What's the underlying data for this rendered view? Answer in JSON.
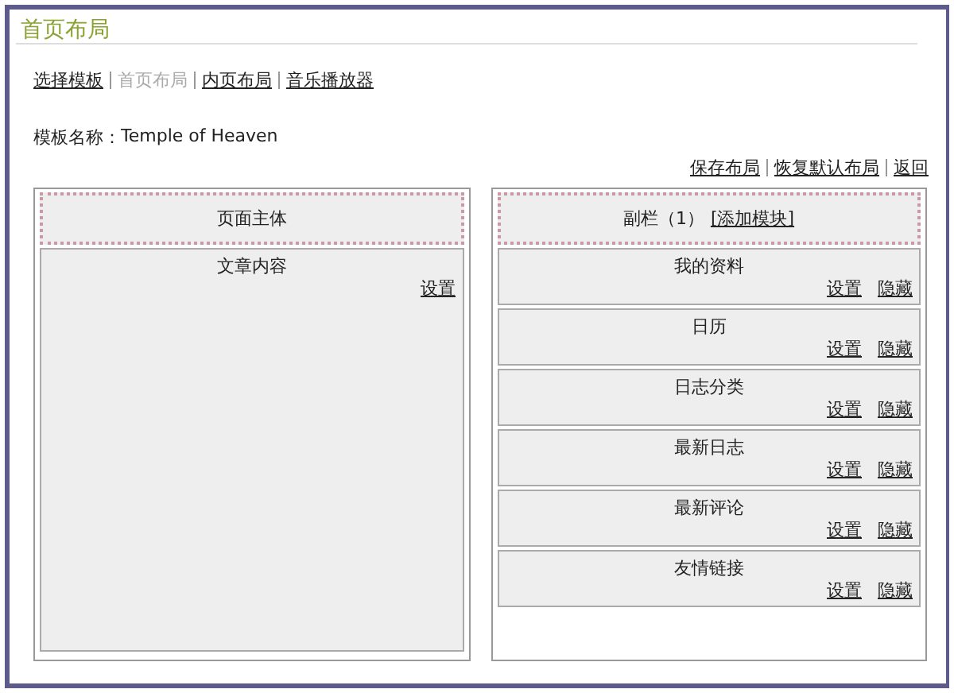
{
  "title": "首页布局",
  "nav": [
    {
      "label": "选择模板",
      "selected": false
    },
    {
      "label": "首页布局",
      "selected": true
    },
    {
      "label": "内页布局",
      "selected": false
    },
    {
      "label": "音乐播放器",
      "selected": false
    }
  ],
  "template_name": {
    "label": "模板名称：",
    "value": "Temple of Heaven"
  },
  "actions": [
    "保存布局",
    "恢复默认布局",
    "返回"
  ],
  "main_column": {
    "header": "页面主体",
    "modules": [
      {
        "title": "文章内容",
        "links": [
          "设置"
        ]
      }
    ]
  },
  "side_column": {
    "header": "副栏（1）",
    "add_link": "[添加模块]",
    "modules": [
      {
        "title": "我的资料",
        "links": [
          "设置",
          "隐藏"
        ]
      },
      {
        "title": "日历",
        "links": [
          "设置",
          "隐藏"
        ]
      },
      {
        "title": "日志分类",
        "links": [
          "设置",
          "隐藏"
        ]
      },
      {
        "title": "最新日志",
        "links": [
          "设置",
          "隐藏"
        ]
      },
      {
        "title": "最新评论",
        "links": [
          "设置",
          "隐藏"
        ]
      },
      {
        "title": "友情链接",
        "links": [
          "设置",
          "隐藏"
        ]
      }
    ]
  }
}
